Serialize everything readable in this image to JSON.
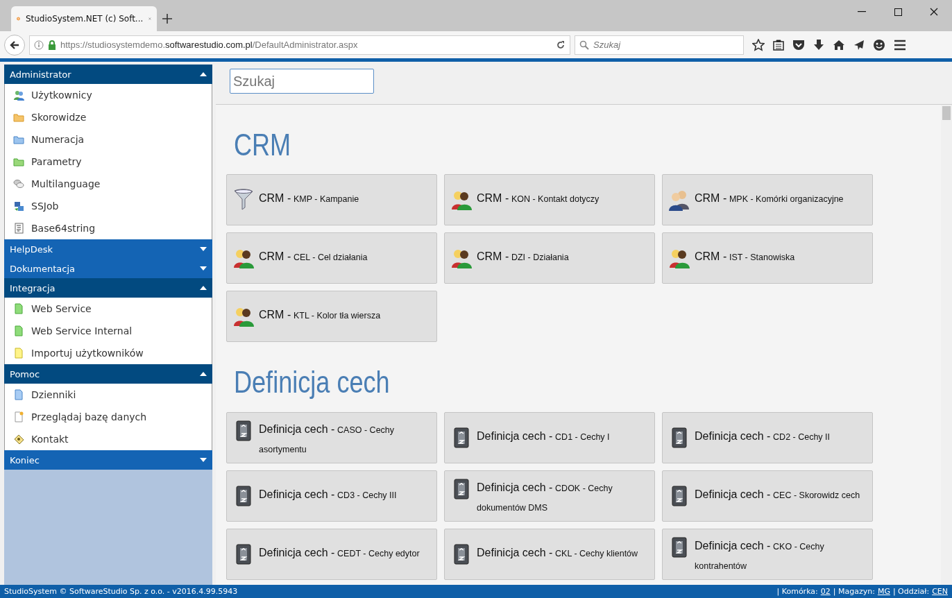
{
  "browser": {
    "tab_title": "StudioSystem.NET (c) Soft...",
    "url": {
      "prefix": "https://studiosystemdemo.",
      "domain": "softwarestudio.com.pl",
      "path": "/DefaultAdministrator.aspx"
    },
    "search": {
      "placeholder": "Szukaj"
    }
  },
  "sidebar": {
    "sections": [
      {
        "title": "Administrator",
        "expanded": true,
        "items": [
          {
            "label": "Użytkownicy",
            "kind": "users"
          },
          {
            "label": "Skorowidze",
            "kind": "orange"
          },
          {
            "label": "Numeracja",
            "kind": "blue"
          },
          {
            "label": "Parametry",
            "kind": "green"
          },
          {
            "label": "Multilanguage",
            "kind": "chat"
          },
          {
            "label": "SSJob",
            "kind": "job"
          },
          {
            "label": "Base64string",
            "kind": "text"
          }
        ]
      },
      {
        "title": "HelpDesk",
        "expanded": false
      },
      {
        "title": "Dokumentacja",
        "expanded": false
      },
      {
        "title": "Integracja",
        "expanded": true,
        "items": [
          {
            "label": "Web Service",
            "kind": "pagegreen"
          },
          {
            "label": "Web Service Internal",
            "kind": "pagegreen"
          },
          {
            "label": "Importuj użytkowników",
            "kind": "pageyellow"
          }
        ]
      },
      {
        "title": "Pomoc",
        "expanded": true,
        "items": [
          {
            "label": "Dzienniki",
            "kind": "pageblue"
          },
          {
            "label": "Przeglądaj bazę danych",
            "kind": "pagenew"
          },
          {
            "label": "Kontakt",
            "kind": "contact"
          }
        ]
      },
      {
        "title": "Koniec",
        "expanded": false
      }
    ]
  },
  "main": {
    "search": {
      "placeholder": "Szukaj"
    },
    "groups": [
      {
        "heading": "CRM",
        "tiles": [
          {
            "title": "CRM -",
            "detail": "KMP - Kampanie",
            "kind": "funnel"
          },
          {
            "title": "CRM -",
            "detail": "KON - Kontakt dotyczy",
            "kind": "pair"
          },
          {
            "title": "CRM -",
            "detail": "MPK - Komórki organizacyjne",
            "kind": "business"
          },
          {
            "title": "CRM -",
            "detail": "CEL - Cel działania",
            "kind": "pair"
          },
          {
            "title": "CRM -",
            "detail": "DZI - Działania",
            "kind": "pair"
          },
          {
            "title": "CRM -",
            "detail": "IST - Stanowiska",
            "kind": "pair"
          },
          {
            "title": "CRM -",
            "detail": "KTL - Kolor tła wiersza",
            "kind": "pair"
          }
        ]
      },
      {
        "heading": "Definicja cech",
        "tiles": [
          {
            "title": "Definicja cech -",
            "detail": "CASO - Cechy asortymentu",
            "kind": "book"
          },
          {
            "title": "Definicja cech -",
            "detail": "CD1 - Cechy I",
            "kind": "book"
          },
          {
            "title": "Definicja cech -",
            "detail": "CD2 - Cechy II",
            "kind": "book"
          },
          {
            "title": "Definicja cech -",
            "detail": "CD3 - Cechy III",
            "kind": "book"
          },
          {
            "title": "Definicja cech -",
            "detail": "CDOK - Cechy dokumentów DMS",
            "kind": "book"
          },
          {
            "title": "Definicja cech -",
            "detail": "CEC - Skorowidz cech",
            "kind": "book"
          },
          {
            "title": "Definicja cech -",
            "detail": "CEDT - Cechy edytor",
            "kind": "book"
          },
          {
            "title": "Definicja cech -",
            "detail": "CKL - Cechy klientów",
            "kind": "book"
          },
          {
            "title": "Definicja cech -",
            "detail": "CKO - Cechy kontrahentów",
            "kind": "book"
          }
        ]
      }
    ]
  },
  "status_bar": {
    "copyright": "StudioSystem © SoftwareStudio Sp. z o.o. - v2016.4.99.5943",
    "fields": [
      {
        "label": "| Komórka:",
        "value": "02"
      },
      {
        "label": "| Magazyn:",
        "value": "MG"
      },
      {
        "label": "| Oddział:",
        "value": "CEN"
      }
    ]
  }
}
